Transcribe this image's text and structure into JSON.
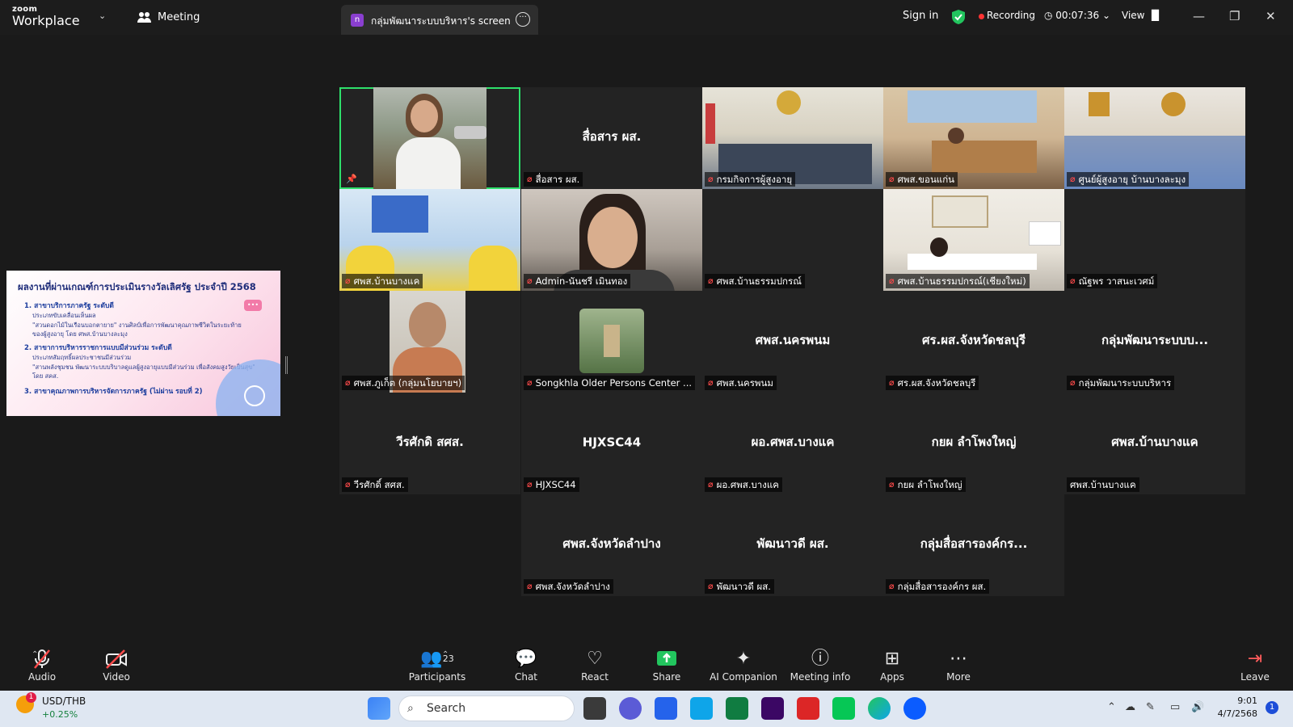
{
  "app": {
    "brand_small": "zoom",
    "brand_big": "Workplace",
    "meeting_label": "Meeting"
  },
  "share_tab": {
    "icon_letter": "n",
    "label": "กลุ่มพัฒนาระบบบริหาร's screen"
  },
  "topbar": {
    "sign_in": "Sign in",
    "recording": "Recording",
    "timer": "00:07:36",
    "view": "View"
  },
  "shared_screen": {
    "title": "ผลงานที่ผ่านเกณฑ์การประเมินรางวัลเลิศรัฐ ประจำปี 2568",
    "lines": [
      "1. สาขาบริการภาครัฐ ระดับดี",
      "ประเภทขับเคลื่อนเห็นผล",
      "\"สวนดอกไม้ในเรือนบอกตายาย\" งานศิลป์เพื่อการพัฒนาคุณภาพชีวิตในระยะท้าย",
      "ของผู้สูงอายุ โดย ศพส.บ้านบางละมุง",
      "2. สาขาการบริหารราชการแบบมีส่วนร่วม ระดับดี",
      "ประเภทสัมฤทธิ์ผลประชาชนมีส่วนร่วม",
      "\"สานพลังชุมชน พัฒนาระบบบริบาลดูแลผู้สูงอายุแบบมีส่วนร่วม เพื่อสังคมสูงวัยเป็นสุข\"",
      "โดย สคส.",
      "3. สาขาคุณภาพการบริหารจัดการภาครัฐ (ไม่ผ่าน รอบที่ 2)"
    ]
  },
  "participants": [
    {
      "name": "",
      "label": "",
      "video": "woman-outdoor",
      "pinned": true,
      "active": true
    },
    {
      "name": "สื่อสาร ผส.",
      "label": "สื่อสาร ผส.",
      "video": ""
    },
    {
      "name": "",
      "label": "กรมกิจการผู้สูงอายุ",
      "video": "meeting-room"
    },
    {
      "name": "",
      "label": "ศพส.ขอนแก่น",
      "video": "office-group"
    },
    {
      "name": "",
      "label": "ศูนย์ผู้สูงอายุ บ้านบางละมุง",
      "video": "conference"
    },
    {
      "name": "",
      "label": "ศพส.บ้านบางแค",
      "video": "yellow-staff"
    },
    {
      "name": "",
      "label": "Admin-นันชรี เมินทอง",
      "video": "woman-close"
    },
    {
      "name": "",
      "label": "ศพส.บ้านธรรมปกรณ์",
      "video": ""
    },
    {
      "name": "",
      "label": "ศพส.บ้านธรรมปกรณ์(เชียงใหม่)",
      "video": "office-woman"
    },
    {
      "name": "",
      "label": "ณัฐพร วาสนะเวศม์",
      "video": ""
    },
    {
      "name": "",
      "label": "ศพส.ภูเก็ต (กลุ่มนโยบายฯ)",
      "video": "man-close"
    },
    {
      "name": "",
      "label": "Songkhla Older Persons Center ...",
      "video": "aerial"
    },
    {
      "name": "ศพส.นครพนม",
      "label": "ศพส.นครพนม",
      "video": ""
    },
    {
      "name": "ศร.ผส.จังหวัดชลบุรี",
      "label": "ศร.ผส.จังหวัดชลบุรี",
      "video": ""
    },
    {
      "name": "กลุ่มพัฒนาระบบบ...",
      "label": "กลุ่มพัฒนาระบบบริหาร",
      "video": ""
    },
    {
      "name": "วีรศักดิ สศส.",
      "label": "วีรศักดิ์ สศส.",
      "video": ""
    },
    {
      "name": "HJXSC44",
      "label": "HJXSC44",
      "video": ""
    },
    {
      "name": "ผอ.ศพส.บางแค",
      "label": "ผอ.ศพส.บางแค",
      "video": ""
    },
    {
      "name": "กยผ ลำโพงใหญ่",
      "label": "กยผ ลำโพงใหญ่",
      "video": ""
    },
    {
      "name": "ศพส.บ้านบางแค",
      "label": "ศพส.บ้านบางแค",
      "video": "",
      "nomic": true
    },
    {
      "name": "ศพส.จังหวัดลำปาง",
      "label": "ศพส.จังหวัดลำปาง",
      "video": ""
    },
    {
      "name": "พัฒนาวดี ผส.",
      "label": "พัฒนาวดี ผส.",
      "video": ""
    },
    {
      "name": "กลุ่มสื่อสารองค์กร...",
      "label": "กลุ่มสื่อสารองค์กร ผส.",
      "video": ""
    }
  ],
  "toolbar": {
    "audio": "Audio",
    "video": "Video",
    "participants": "Participants",
    "participants_count": "23",
    "chat": "Chat",
    "react": "React",
    "share": "Share",
    "ai": "AI Companion",
    "info": "Meeting info",
    "apps": "Apps",
    "more": "More",
    "leave": "Leave"
  },
  "taskbar": {
    "ticker": "USD/THB",
    "ticker_change": "+0.25%",
    "ticker_badge": "1",
    "search": "Search",
    "time": "9:01",
    "date": "4/7/2568",
    "notif": "1"
  },
  "colors": {
    "accent_green": "#2ee06b",
    "recording_red": "#ff3333",
    "share_green": "#22c55e",
    "muted_red": "#ff4b4b"
  }
}
